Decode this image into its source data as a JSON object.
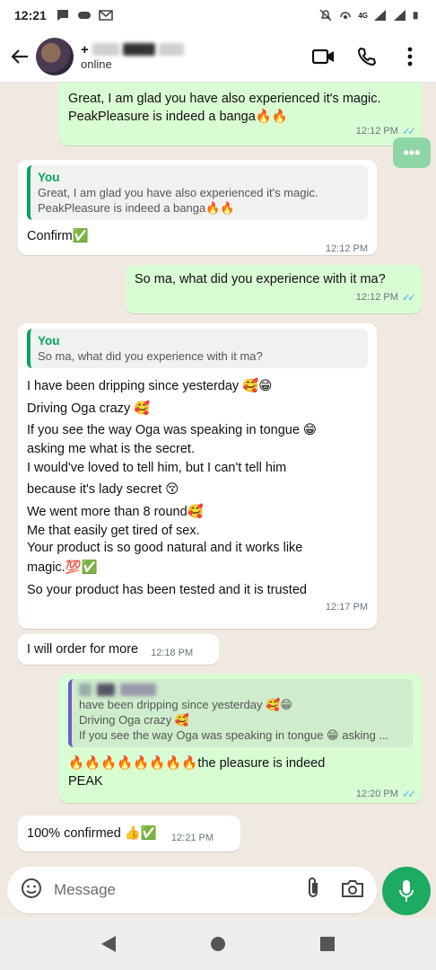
{
  "status_bar": {
    "time": "12:21",
    "network": "4G"
  },
  "header": {
    "contact_name_prefix": "+",
    "contact_status": "online"
  },
  "messages": {
    "m1": {
      "line1": "Great, I am glad you have also experienced it's magic.",
      "line2": "PeakPleasure is indeed a banga🔥🔥",
      "time": "12:12 PM"
    },
    "m2": {
      "quote_author": "You",
      "quote_line1": "Great, I am glad you have also experienced it's magic.",
      "quote_line2": "PeakPleasure is indeed a banga🔥🔥",
      "text": "Confirm✅",
      "time": "12:12 PM"
    },
    "m3": {
      "text": "So ma, what did you experience with it ma?",
      "time": "12:12 PM"
    },
    "m4": {
      "quote_author": "You",
      "quote_text": "So ma, what did you experience with it ma?",
      "lines": [
        "I have been dripping since yesterday 🥰😁",
        "Driving Oga crazy 🥰",
        "If you see the way Oga was speaking in tongue 😁",
        "asking me what is the secret.",
        "I would've loved to tell him, but I can't tell him",
        "because it's lady secret 😚",
        "We went more than 8 round🥰",
        "Me that easily get tired of sex.",
        "Your product is so good natural and it works like",
        "magic.💯✅",
        "So your product has been tested and it is trusted"
      ],
      "time": "12:17 PM"
    },
    "m5": {
      "text": "I will order for more",
      "time": "12:18 PM"
    },
    "m6": {
      "quote_line1": "have been dripping since yesterday 🥰😁",
      "quote_line2": "Driving Oga crazy 🥰",
      "quote_line3": "If you see the way Oga was speaking in tongue 😁 asking ...",
      "line1": "🔥🔥🔥🔥🔥🔥🔥🔥the pleasure is indeed",
      "line2": "PEAK",
      "time": "12:20 PM"
    },
    "m7": {
      "text": "100% confirmed 👍✅",
      "time": "12:21 PM"
    }
  },
  "composer": {
    "placeholder": "Message"
  },
  "colors": {
    "outgoing": "#d9fdd3",
    "incoming": "#ffffff",
    "accent": "#1daa61",
    "read_tick": "#53bdeb"
  }
}
